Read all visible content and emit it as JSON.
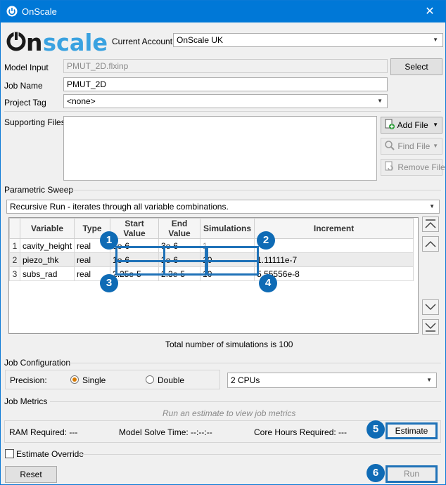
{
  "window": {
    "title": "OnScale",
    "close_glyph": "✕"
  },
  "logo": {
    "text": "onscale"
  },
  "account": {
    "label": "Current Account:",
    "value": "OnScale UK"
  },
  "model_input": {
    "label": "Model Input",
    "value": "PMUT_2D.flxinp",
    "select_label": "Select"
  },
  "job_name": {
    "label": "Job Name",
    "value": "PMUT_2D"
  },
  "project_tag": {
    "label": "Project Tag",
    "value": "<none>"
  },
  "supporting_files": {
    "label": "Supporting Files",
    "add_label": "Add File",
    "find_label": "Find File",
    "remove_label": "Remove File"
  },
  "sweep": {
    "section": "Parametric Sweep",
    "mode": "Recursive Run  -  iterates through all variable combinations.",
    "columns": [
      "Variable",
      "Type",
      "Start Value",
      "End Value",
      "Simulations",
      "Increment"
    ],
    "rows": [
      {
        "n": "1",
        "variable": "cavity_height",
        "type": "real",
        "start": "3e-6",
        "end": "3e-6",
        "sims": "1",
        "inc": ""
      },
      {
        "n": "2",
        "variable": "piezo_thk",
        "type": "real",
        "start": "1e-6",
        "end": "2e-6",
        "sims": "10",
        "inc": "1.11111e-7"
      },
      {
        "n": "3",
        "variable": "subs_rad",
        "type": "real",
        "start": "2.25e-5",
        "end": "2.3e-5",
        "sims": "10",
        "inc": "5.55556e-8"
      }
    ],
    "total": "Total number of simulations is 100"
  },
  "callouts": [
    "1",
    "2",
    "3",
    "4",
    "5",
    "6"
  ],
  "job_config": {
    "section": "Job Configuration",
    "precision_label": "Precision:",
    "single_label": "Single",
    "double_label": "Double",
    "cpus": "2 CPUs"
  },
  "metrics": {
    "section": "Job Metrics",
    "hint": "Run an estimate to view job metrics",
    "ram": "RAM Required: ---",
    "solve": "Model Solve Time: --:--:--",
    "core": "Core Hours Required: ---",
    "estimate_label": "Estimate"
  },
  "estimate_override": {
    "label": "Estimate Override"
  },
  "footer": {
    "reset_label": "Reset",
    "run_label": "Run"
  },
  "colors": {
    "titlebar": "#0078d7",
    "callout": "#0f6bb5",
    "highlight": "#1f72b8",
    "radio_on": "#d77a00"
  }
}
